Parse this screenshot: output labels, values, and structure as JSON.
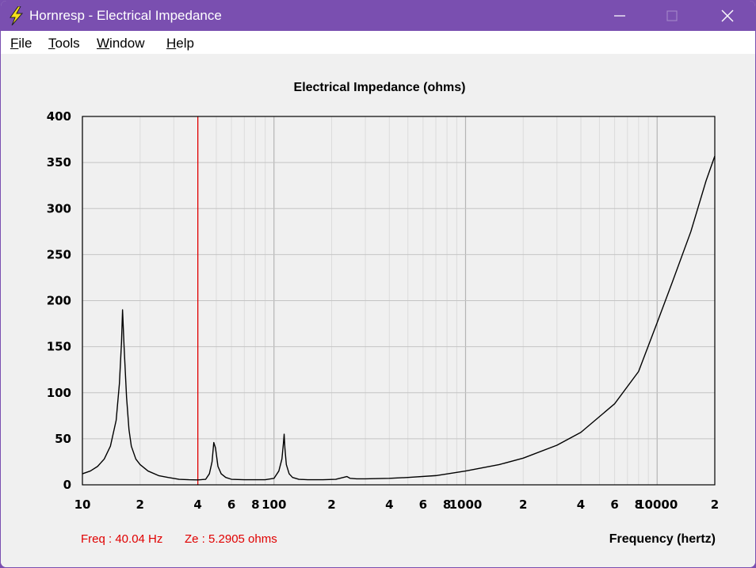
{
  "window": {
    "title": "Hornresp - Electrical Impedance",
    "icon": "lightning-icon",
    "controls": [
      "minimize-icon",
      "maximize-icon",
      "close-icon"
    ],
    "titlebar_color": "#7a4fb0"
  },
  "menu": [
    {
      "mnemonic": "F",
      "rest": "ile"
    },
    {
      "mnemonic": "T",
      "rest": "ools"
    },
    {
      "mnemonic": "W",
      "rest": "indow"
    },
    {
      "mnemonic": "H",
      "rest": "elp"
    }
  ],
  "readout": {
    "freq": "Freq : 40.04 Hz",
    "ze": "Ze : 5.2905 ohms"
  },
  "chart_data": {
    "type": "line",
    "title": "Electrical Impedance (ohms)",
    "xlabel": "Frequency (hertz)",
    "ylabel": "",
    "x_scale": "log",
    "xlim": [
      10,
      20000
    ],
    "ylim": [
      0,
      400
    ],
    "y_ticks": [
      "0",
      "50",
      "100",
      "150",
      "200",
      "250",
      "300",
      "350",
      "400"
    ],
    "x_ticks": [
      {
        "value": 10,
        "label": "10"
      },
      {
        "value": 20,
        "label": "2"
      },
      {
        "value": 40,
        "label": "4"
      },
      {
        "value": 60,
        "label": "6"
      },
      {
        "value": 80,
        "label": "8"
      },
      {
        "value": 100,
        "label": "100"
      },
      {
        "value": 200,
        "label": "2"
      },
      {
        "value": 400,
        "label": "4"
      },
      {
        "value": 600,
        "label": "6"
      },
      {
        "value": 800,
        "label": "8"
      },
      {
        "value": 1000,
        "label": "1000"
      },
      {
        "value": 2000,
        "label": "2"
      },
      {
        "value": 4000,
        "label": "4"
      },
      {
        "value": 6000,
        "label": "6"
      },
      {
        "value": 8000,
        "label": "8"
      },
      {
        "value": 10000,
        "label": "10000"
      },
      {
        "value": 20000,
        "label": "2"
      }
    ],
    "grid": true,
    "cursor_frequency": 40.04,
    "line_color": "#000000",
    "cursor_color": "#e00000",
    "series": [
      {
        "x": [
          10,
          11,
          12,
          13,
          14,
          15,
          15.6,
          16,
          16.2,
          16.5,
          17,
          17.5,
          18,
          19,
          20,
          22,
          25,
          28,
          32,
          36,
          40,
          44,
          46,
          47.5,
          48.5,
          49.5,
          51,
          53,
          56,
          60,
          70,
          80,
          90,
          100,
          106,
          110,
          112,
          113,
          114,
          116,
          120,
          125,
          135,
          150,
          180,
          210,
          230,
          240,
          250,
          270,
          300,
          400,
          500,
          700,
          1000,
          1500,
          2000,
          3000,
          4000,
          6000,
          8000,
          10000,
          12000,
          15000,
          18000,
          20000
        ],
        "y": [
          12,
          15,
          20,
          28,
          42,
          70,
          110,
          155,
          190,
          150,
          95,
          60,
          42,
          28,
          22,
          15,
          10,
          8,
          6,
          5.5,
          5.3,
          6,
          12,
          25,
          46,
          40,
          20,
          12,
          8,
          6,
          5.5,
          5.5,
          5.5,
          7,
          15,
          28,
          45,
          55,
          40,
          22,
          12,
          8,
          6,
          5.5,
          5.5,
          6,
          8,
          9,
          7,
          6.5,
          6.5,
          7,
          8,
          10,
          15,
          22,
          29,
          43,
          57,
          88,
          123,
          176,
          220,
          275,
          330,
          357
        ]
      }
    ]
  }
}
